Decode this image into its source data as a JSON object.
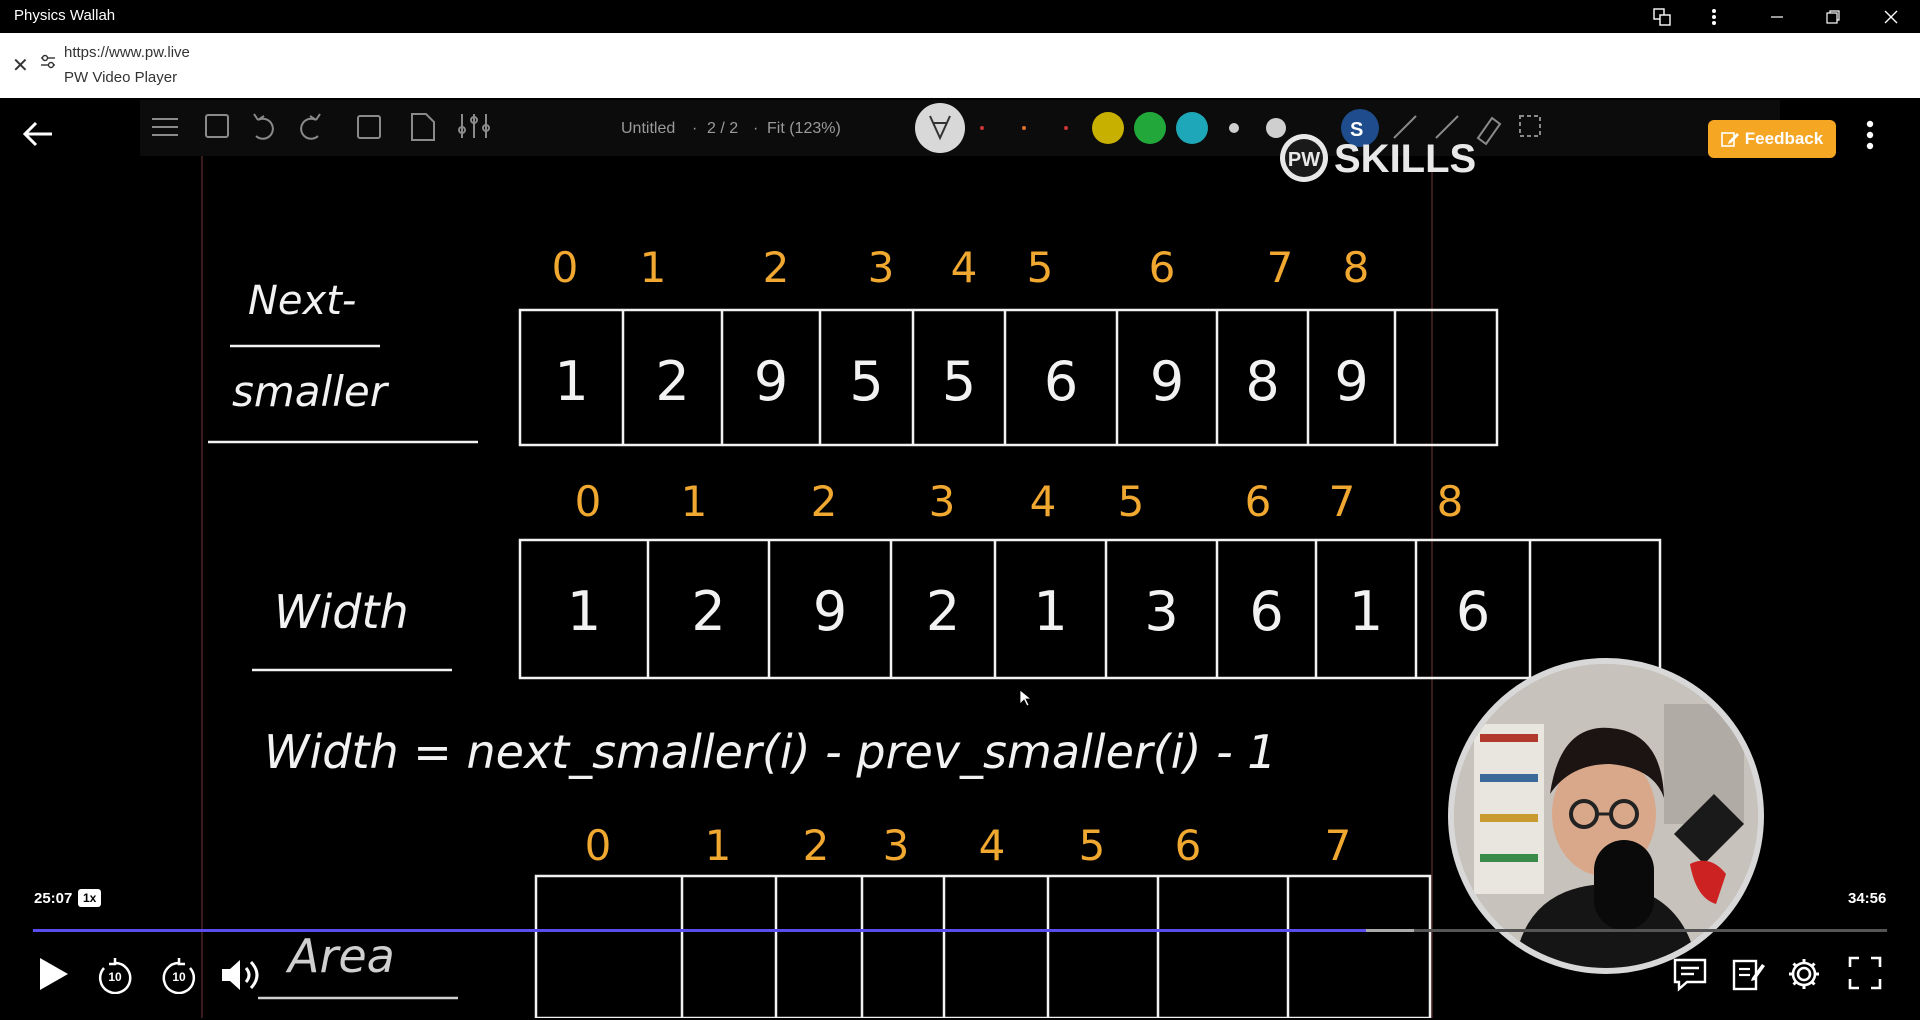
{
  "window": {
    "title": "Physics Wallah"
  },
  "address_bar": {
    "url": "https://www.pw.live",
    "page_title": "PW Video Player"
  },
  "board": {
    "doc_title": "Untitled",
    "separator": "·",
    "page_indicator": "2 / 2",
    "zoom": "Fit (123%)",
    "brand": "SKILLS",
    "brand_logo_text": "PW",
    "rows": {
      "next_smaller": {
        "label_line1": "Next-",
        "label_line2": "smaller",
        "indices": [
          "0",
          "1",
          "2",
          "3",
          "4",
          "5",
          "6",
          "7",
          "8"
        ],
        "values": [
          "1",
          "2",
          "9",
          "5",
          "5",
          "6",
          "9",
          "8",
          "9",
          ""
        ]
      },
      "width": {
        "label": "Width",
        "indices": [
          "0",
          "1",
          "2",
          "3",
          "4",
          "5",
          "6",
          "7",
          "8"
        ],
        "values": [
          "1",
          "2",
          "9",
          "2",
          "1",
          "3",
          "6",
          "1",
          "6",
          ""
        ]
      },
      "formula": "Width = next_smaller(i) - prev_smaller(i) - 1",
      "area": {
        "label": "Area",
        "indices": [
          "0",
          "1",
          "2",
          "3",
          "4",
          "5",
          "6",
          "7"
        ]
      }
    }
  },
  "player": {
    "feedback_label": "Feedback",
    "current_time": "25:07",
    "duration": "34:56",
    "speed": "1x",
    "progress_fraction": 0.719,
    "buffered_fraction": 0.745,
    "skip_back_seconds": "10",
    "skip_forward_seconds": "10"
  },
  "colors": {
    "accent": "#5b4cf0",
    "feedback": "#f5a623",
    "chalk_yellow": "#f0a830",
    "chalk_white": "#f2f2f2"
  }
}
